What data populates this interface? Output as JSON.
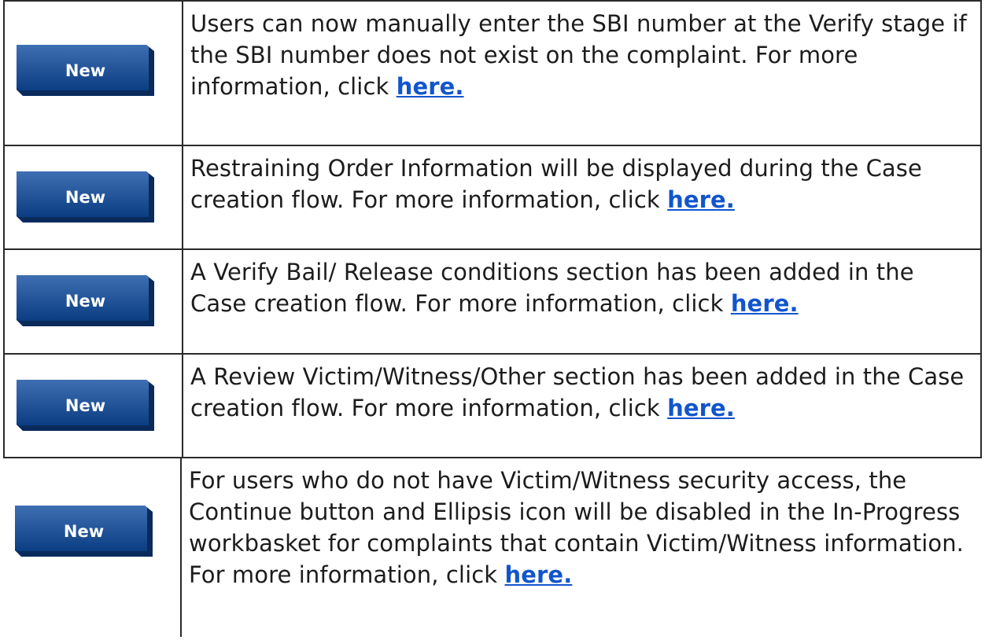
{
  "colors": {
    "badge_fill_top": "#3f6fb3",
    "badge_fill_bottom": "#0b3d82",
    "badge_edge": "#0a2a5c",
    "link": "#1155cc",
    "border": "#2a2a2a"
  },
  "rows": [
    {
      "badge": "New",
      "text": "Users can now manually enter the SBI number at the Verify stage if the SBI number does not exist on the complaint. For more information, click",
      "link": "here."
    },
    {
      "badge": "New",
      "text": "Restraining Order Information will be displayed during the Case creation flow. For more information, click",
      "link": "here."
    },
    {
      "badge": "New",
      "text": "A Verify Bail/ Release conditions section has been added in the Case creation flow. For more information, click",
      "link": "here."
    },
    {
      "badge": "New",
      "text": "A Review Victim/Witness/Other section has been added in the Case creation flow. For more information, click",
      "link": "here."
    },
    {
      "badge": "New",
      "text": "For users who do not have Victim/Witness security access, the Continue button and Ellipsis icon will be disabled in the In-Progress workbasket for complaints that contain Victim/Witness information. For more information, click",
      "link": "here."
    }
  ]
}
